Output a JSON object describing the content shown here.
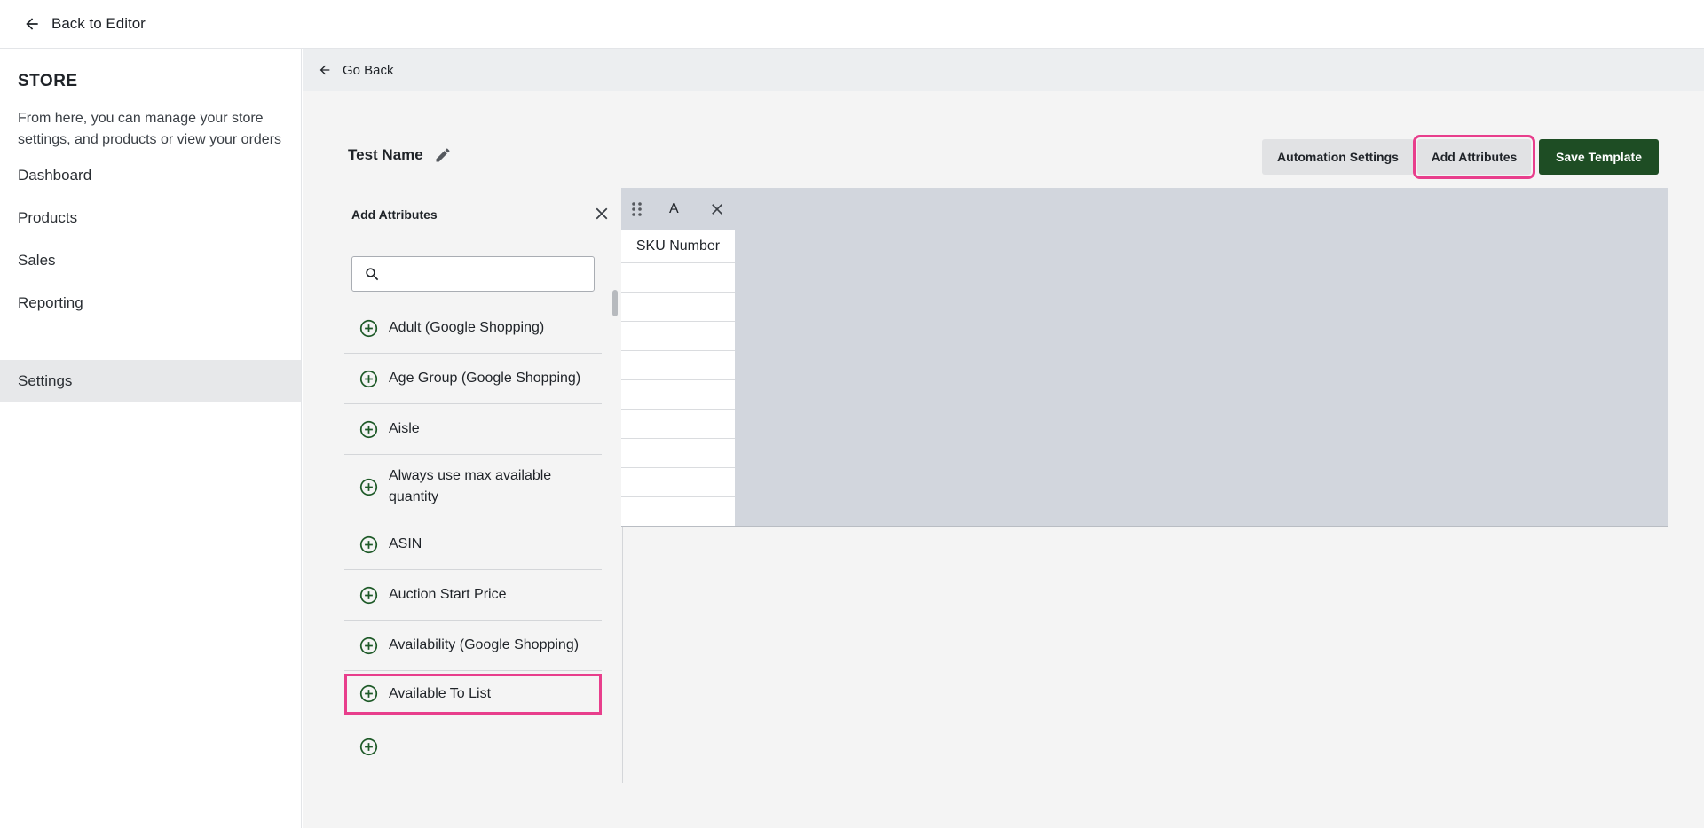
{
  "topbar": {
    "back_label": "Back to Editor"
  },
  "sidebar": {
    "title": "STORE",
    "description": "From here, you can manage your store settings, and products or view your orders",
    "items": [
      {
        "label": "Dashboard"
      },
      {
        "label": "Products"
      },
      {
        "label": "Sales"
      },
      {
        "label": "Reporting"
      },
      {
        "label": "Settings",
        "active": true
      }
    ]
  },
  "main": {
    "go_back_label": "Go Back",
    "template_name": "Test Name",
    "buttons": {
      "automation": "Automation Settings",
      "add_attributes": "Add Attributes",
      "save": "Save Template"
    }
  },
  "panel": {
    "title": "Add Attributes",
    "search": {
      "value": "",
      "placeholder": ""
    },
    "items": [
      {
        "label": "Adult (Google Shopping)"
      },
      {
        "label": "Age Group (Google Shopping)"
      },
      {
        "label": "Aisle"
      },
      {
        "label": "Always use max available quantity"
      },
      {
        "label": "ASIN"
      },
      {
        "label": "Auction Start Price"
      },
      {
        "label": "Availability (Google Shopping)"
      },
      {
        "label": "Available To List",
        "highlighted": true
      }
    ]
  },
  "grid": {
    "columns": [
      {
        "letter": "A",
        "header": "SKU Number"
      }
    ]
  },
  "colors": {
    "accent_green": "#1e4d24",
    "highlight_pink": "#e83e8c",
    "icon_green": "#1e5a28"
  },
  "icons": {
    "back": "arrow-left-icon",
    "edit": "pencil-icon",
    "close": "close-icon",
    "search": "search-icon",
    "add": "plus-circle-icon",
    "drag": "drag-handle-icon"
  }
}
